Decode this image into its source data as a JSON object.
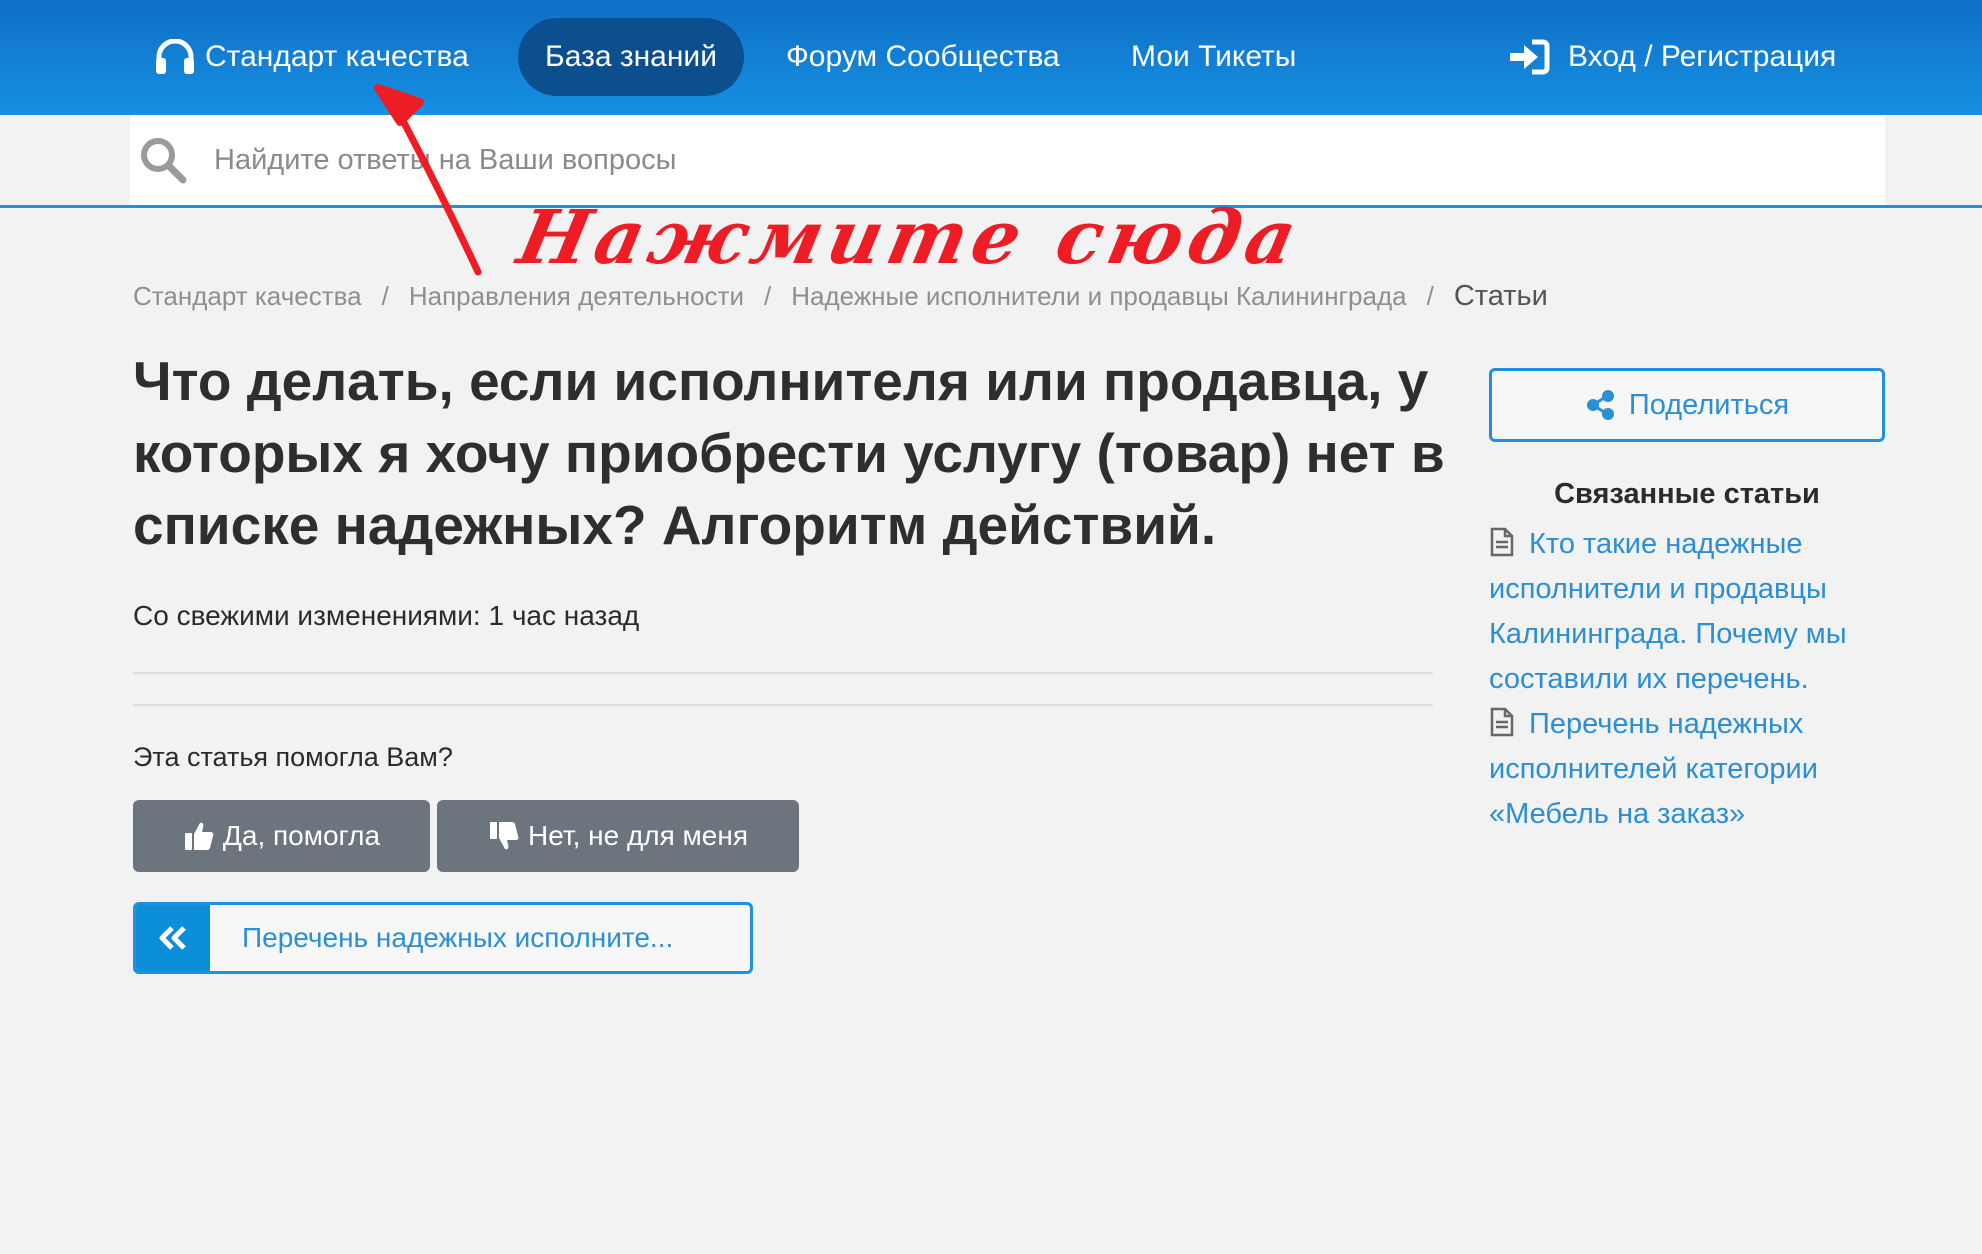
{
  "header": {
    "brand_label": "Стандарт качества",
    "nav": {
      "knowledge_base": "База знаний",
      "forum": "Форум Сообщества",
      "tickets": "Мои Тикеты"
    },
    "login_label": "Вход / Регистрация"
  },
  "search": {
    "placeholder": "Найдите ответы на Ваши вопросы",
    "value": ""
  },
  "annotation": {
    "text": "Нажмите сюда",
    "color": "#ee1c24"
  },
  "breadcrumb": {
    "items": [
      "Стандарт качества",
      "Направления деятельности",
      "Надежные исполнители и продавцы Калининграда"
    ],
    "current": "Статьи",
    "separator": "/"
  },
  "article": {
    "title": "Что делать, если исполнителя или продавца, у которых я хочу приобрести услугу (товар) нет в списке надежных? Алгоритм действий.",
    "updated": "Со свежими изменениями: 1 час назад",
    "helpful_question": "Эта статья помогла Вам?",
    "vote_yes": "Да, помогла",
    "vote_no": "Нет, не для меня",
    "prev_article": "Перечень надежных исполните..."
  },
  "sidebar": {
    "share_label": "Поделиться",
    "related_title": "Связанные статьи",
    "related": [
      "Кто такие надежные исполнители и продавцы Калининграда. Почему мы составили их перечень.",
      "Перечень надежных исполнителей категории «Мебель на заказ»"
    ]
  },
  "colors": {
    "header": "#1590e2",
    "active_nav": "#0b4f8f",
    "link": "#2a8fd6",
    "button_gray": "#6c757d"
  },
  "icons": {
    "brand": "headset-icon",
    "login": "sign-in-icon",
    "search": "search-icon",
    "share": "share-icon",
    "doc": "document-icon",
    "thumbs_up": "thumbs-up-icon",
    "thumbs_down": "thumbs-down-icon",
    "prev": "double-chevron-left-icon"
  }
}
